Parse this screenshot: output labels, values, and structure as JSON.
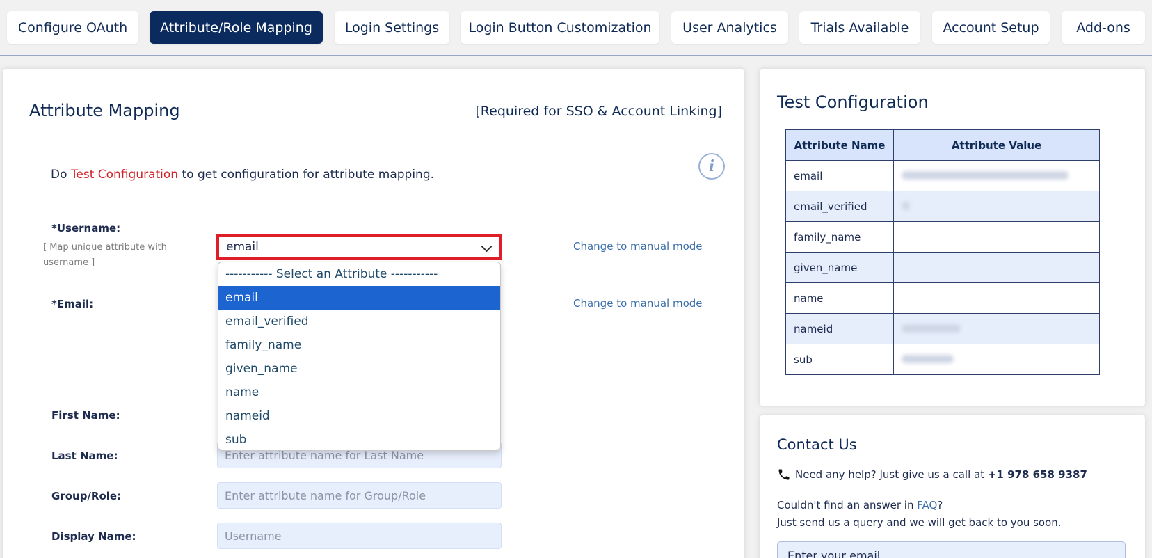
{
  "tabs": [
    {
      "label": "Configure OAuth",
      "active": false
    },
    {
      "label": "Attribute/Role Mapping",
      "active": true
    },
    {
      "label": "Login Settings",
      "active": false
    },
    {
      "label": "Login Button Customization",
      "active": false
    },
    {
      "label": "User Analytics",
      "active": false
    },
    {
      "label": "Trials Available",
      "active": false
    },
    {
      "label": "Account Setup",
      "active": false
    },
    {
      "label": "Add-ons",
      "active": false
    }
  ],
  "attribute_mapping": {
    "title": "Attribute Mapping",
    "required_note": "[Required for SSO & Account Linking]",
    "hint_prefix": "Do ",
    "hint_link": "Test Configuration",
    "hint_suffix": " to get configuration for attribute mapping.",
    "username_label": "*Username:",
    "username_sublabel": "[ Map unique attribute with username ]",
    "username_selected": "email",
    "email_label": "*Email:",
    "change_manual": "Change to manual mode",
    "first_name_label": "First Name:",
    "last_name_label": "Last Name:",
    "last_name_placeholder": "Enter attribute name for Last Name",
    "group_label": "Group/Role:",
    "group_placeholder": "Enter attribute name for Group/Role",
    "display_label": "Display Name:",
    "display_placeholder": "Username"
  },
  "dropdown": {
    "options": [
      "----------- Select an Attribute -----------",
      "email",
      "email_verified",
      "family_name",
      "given_name",
      "name",
      "nameid",
      "sub"
    ],
    "selected_index": 1
  },
  "test_config": {
    "title": "Test Configuration",
    "headers": [
      "Attribute Name",
      "Attribute Value"
    ],
    "rows": [
      "email",
      "email_verified",
      "family_name",
      "given_name",
      "name",
      "nameid",
      "sub"
    ]
  },
  "contact": {
    "title": "Contact Us",
    "help_text": "Need any help? Just give us a call at ",
    "phone": "+1 978 658 9387",
    "faq_prefix": "Couldn't find an answer in ",
    "faq_link": "FAQ",
    "faq_suffix": "?",
    "query_text": "Just send us a query and we will get back to you soon.",
    "email_placeholder": "Enter your email"
  },
  "colors": {
    "accent": "#0b2a5e",
    "highlight": "#e01e2a",
    "selected_option": "#1c64d0"
  }
}
